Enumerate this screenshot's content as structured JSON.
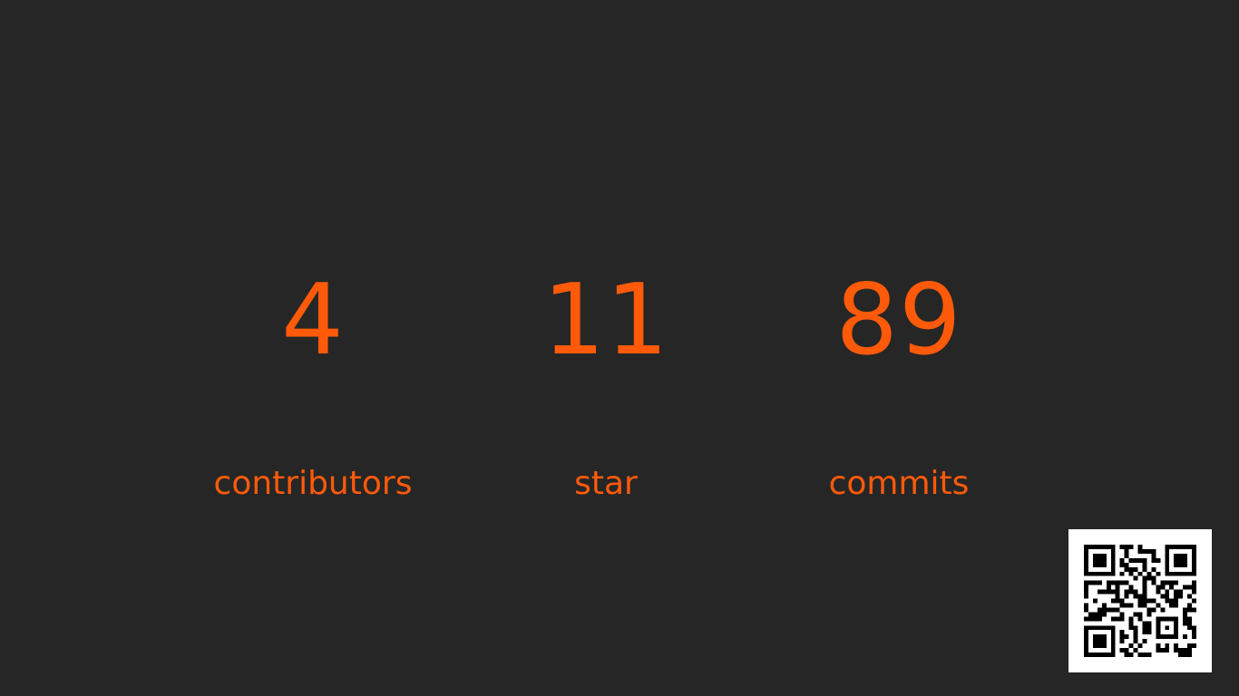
{
  "colors": {
    "background": "#262626",
    "accent": "#ff5a0a",
    "qr_background": "#ffffff",
    "qr_foreground": "#000000"
  },
  "stats": [
    {
      "value": "4",
      "label": "contributors"
    },
    {
      "value": "11",
      "label": "star"
    },
    {
      "value": "89",
      "label": "commits"
    }
  ],
  "qr_code": {
    "icon": "qr-code-icon"
  }
}
